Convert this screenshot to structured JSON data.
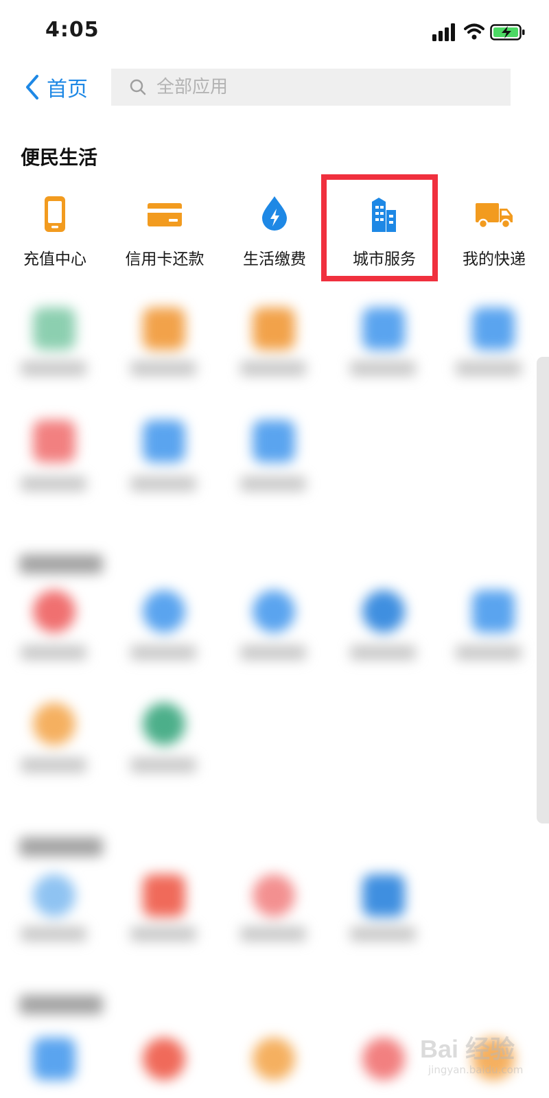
{
  "status_bar": {
    "time": "4:05"
  },
  "header": {
    "back_label": "首页",
    "search_placeholder": "全部应用"
  },
  "section": {
    "title": "便民生活",
    "apps": [
      {
        "label": "充值中心",
        "icon": "phone-icon",
        "color": "#f29b1f"
      },
      {
        "label": "信用卡还款",
        "icon": "credit-card-icon",
        "color": "#f29b1f"
      },
      {
        "label": "生活缴费",
        "icon": "water-bolt-icon",
        "color": "#1e88e5"
      },
      {
        "label": "城市服务",
        "icon": "city-building-icon",
        "color": "#1e88e5"
      },
      {
        "label": "我的快递",
        "icon": "delivery-truck-icon",
        "color": "#f29b1f"
      }
    ]
  },
  "highlight": {
    "color": "#f0303e",
    "target": "城市服务"
  },
  "colors": {
    "accent": "#1e88e5",
    "orange": "#f29b1f",
    "highlight": "#f0303e"
  },
  "watermark": {
    "brand": "Bai 经验",
    "domain": "jingyan.baidu.com"
  }
}
